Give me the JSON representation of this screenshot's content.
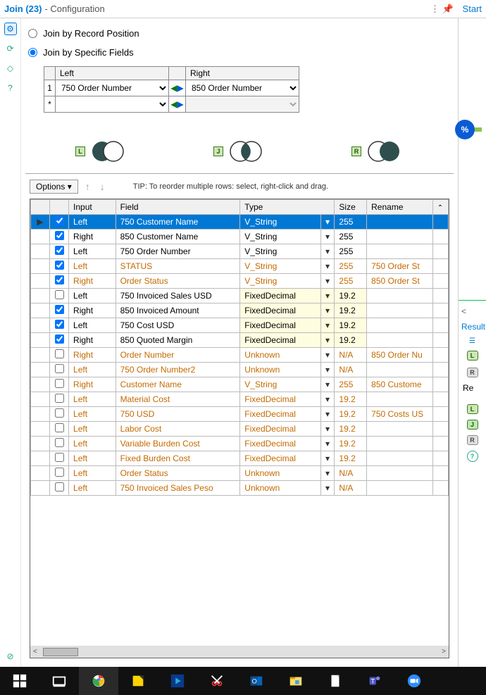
{
  "header": {
    "tool": "Join (23)",
    "sub": "- Configuration",
    "start": "Start"
  },
  "radios": {
    "byPosition": "Join by Record Position",
    "byFields": "Join by Specific Fields",
    "selected": "byFields"
  },
  "joinMap": {
    "leftHeader": "Left",
    "rightHeader": "Right",
    "rows": [
      {
        "idx": "1",
        "left": "750 Order Number",
        "right": "850 Order Number"
      },
      {
        "idx": "*",
        "left": "",
        "right": ""
      }
    ]
  },
  "venn": {
    "L": "L",
    "J": "J",
    "R": "R"
  },
  "optionsBar": {
    "options": "Options",
    "tip": "TIP: To reorder multiple rows: select, right-click and drag."
  },
  "gridHeaders": {
    "input": "Input",
    "field": "Field",
    "type": "Type",
    "size": "Size",
    "rename": "Rename"
  },
  "rows": [
    {
      "sel": true,
      "chk": true,
      "input": "Left",
      "field": "750 Customer Name",
      "type": "V_String",
      "size": "255",
      "rename": "",
      "mod": false
    },
    {
      "sel": false,
      "chk": true,
      "input": "Right",
      "field": "850 Customer Name",
      "type": "V_String",
      "size": "255",
      "rename": "",
      "mod": false
    },
    {
      "sel": false,
      "chk": true,
      "input": "Left",
      "field": "750 Order Number",
      "type": "V_String",
      "size": "255",
      "rename": "",
      "mod": false
    },
    {
      "sel": false,
      "chk": true,
      "input": "Left",
      "field": "STATUS",
      "type": "V_String",
      "size": "255",
      "rename": "750 Order St",
      "mod": true
    },
    {
      "sel": false,
      "chk": true,
      "input": "Right",
      "field": "Order Status",
      "type": "V_String",
      "size": "255",
      "rename": "850 Order St",
      "mod": true
    },
    {
      "sel": false,
      "chk": false,
      "input": "Left",
      "field": "750 Invoiced Sales USD",
      "type": "FixedDecimal",
      "size": "19.2",
      "rename": "",
      "mod": false,
      "hlType": true
    },
    {
      "sel": false,
      "chk": true,
      "input": "Right",
      "field": "850 Invoiced Amount",
      "type": "FixedDecimal",
      "size": "19.2",
      "rename": "",
      "mod": false,
      "hlType": true
    },
    {
      "sel": false,
      "chk": true,
      "input": "Left",
      "field": "750 Cost USD",
      "type": "FixedDecimal",
      "size": "19.2",
      "rename": "",
      "mod": false,
      "hlType": true
    },
    {
      "sel": false,
      "chk": true,
      "input": "Right",
      "field": "850 Quoted Margin",
      "type": "FixedDecimal",
      "size": "19.2",
      "rename": "",
      "mod": false,
      "hlType": true
    },
    {
      "sel": false,
      "chk": false,
      "input": "Right",
      "field": "Order Number",
      "type": "Unknown",
      "size": "N/A",
      "rename": "850 Order Nu",
      "mod": true
    },
    {
      "sel": false,
      "chk": false,
      "input": "Left",
      "field": "750 Order Number2",
      "type": "Unknown",
      "size": "N/A",
      "rename": "",
      "mod": true
    },
    {
      "sel": false,
      "chk": false,
      "input": "Right",
      "field": "Customer Name",
      "type": "V_String",
      "size": "255",
      "rename": "850 Custome",
      "mod": true
    },
    {
      "sel": false,
      "chk": false,
      "input": "Left",
      "field": "Material Cost",
      "type": "FixedDecimal",
      "size": "19.2",
      "rename": "",
      "mod": true
    },
    {
      "sel": false,
      "chk": false,
      "input": "Left",
      "field": "750 USD",
      "type": "FixedDecimal",
      "size": "19.2",
      "rename": "750 Costs US",
      "mod": true
    },
    {
      "sel": false,
      "chk": false,
      "input": "Left",
      "field": "Labor Cost",
      "type": "FixedDecimal",
      "size": "19.2",
      "rename": "",
      "mod": true
    },
    {
      "sel": false,
      "chk": false,
      "input": "Left",
      "field": "Variable Burden Cost",
      "type": "FixedDecimal",
      "size": "19.2",
      "rename": "",
      "mod": true
    },
    {
      "sel": false,
      "chk": false,
      "input": "Left",
      "field": "Fixed Burden Cost",
      "type": "FixedDecimal",
      "size": "19.2",
      "rename": "",
      "mod": true
    },
    {
      "sel": false,
      "chk": false,
      "input": "Left",
      "field": "Order Status",
      "type": "Unknown",
      "size": "N/A",
      "rename": "",
      "mod": true
    },
    {
      "sel": false,
      "chk": false,
      "input": "Left",
      "field": "750 Invoiced Sales Peso",
      "type": "Unknown",
      "size": "N/A",
      "rename": "",
      "mod": true
    }
  ],
  "rightStrip": {
    "results": "Result",
    "re": "Re"
  }
}
